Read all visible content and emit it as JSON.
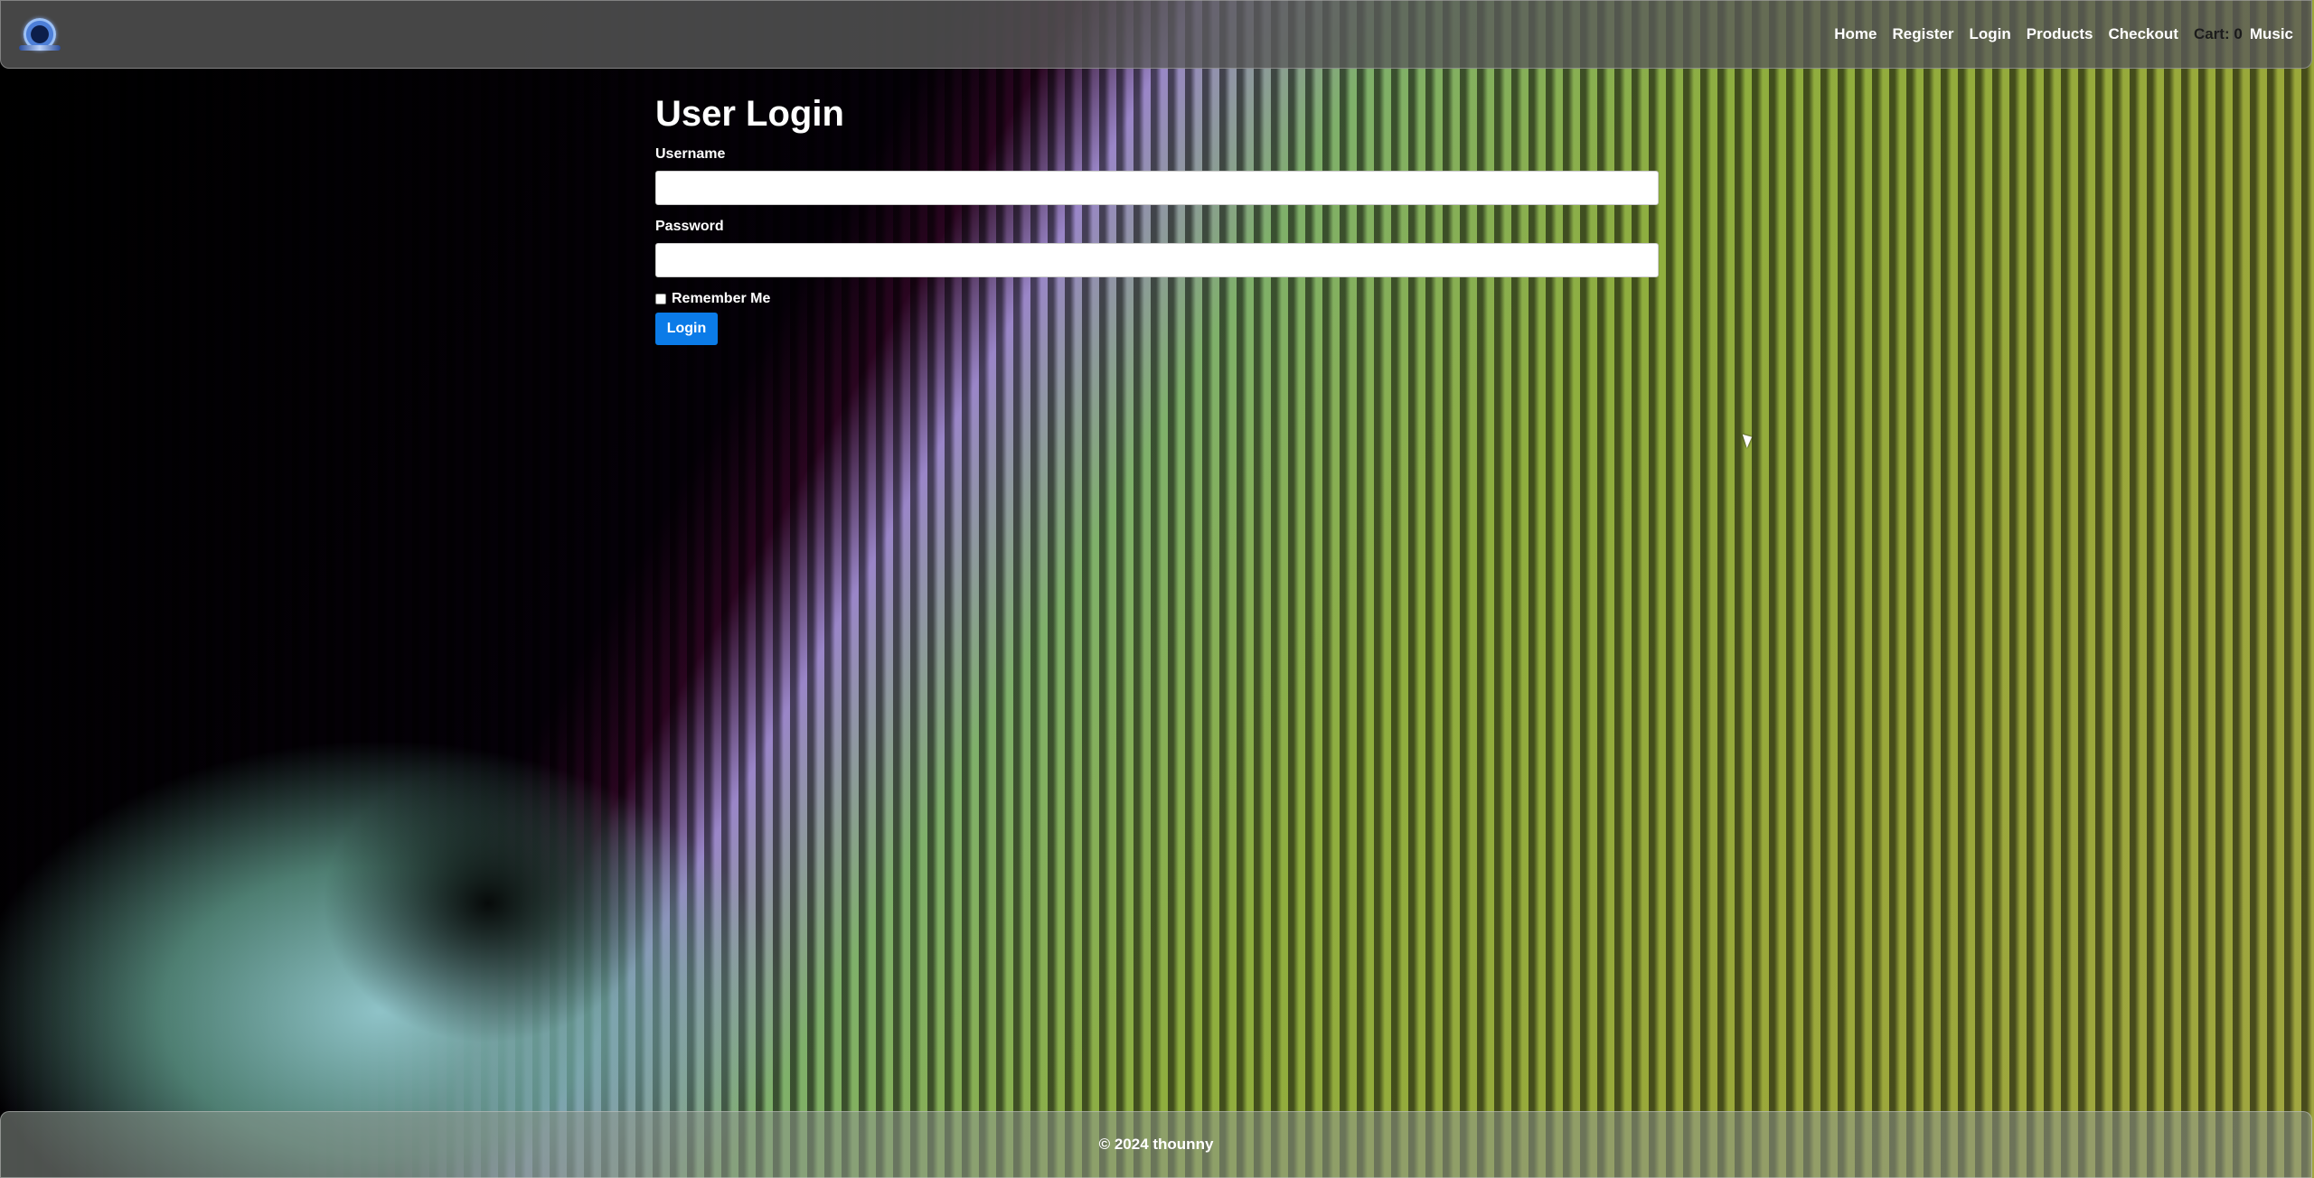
{
  "navbar": {
    "logo_icon": "headphones-logo-icon",
    "links": [
      {
        "label": "Home"
      },
      {
        "label": "Register"
      },
      {
        "label": "Login"
      },
      {
        "label": "Products"
      },
      {
        "label": "Checkout"
      }
    ],
    "cart_label": "Cart:",
    "cart_count": "0",
    "music_label": "Music"
  },
  "main": {
    "title": "User Login",
    "username_label": "Username",
    "username_value": "",
    "password_label": "Password",
    "password_value": "",
    "remember_label": "Remember Me",
    "login_button": "Login"
  },
  "footer": {
    "text": "© 2024 thounny"
  },
  "colors": {
    "accent": "#0b7be8",
    "navbar_bg": "#5a5a5a",
    "text": "#ffffff"
  }
}
